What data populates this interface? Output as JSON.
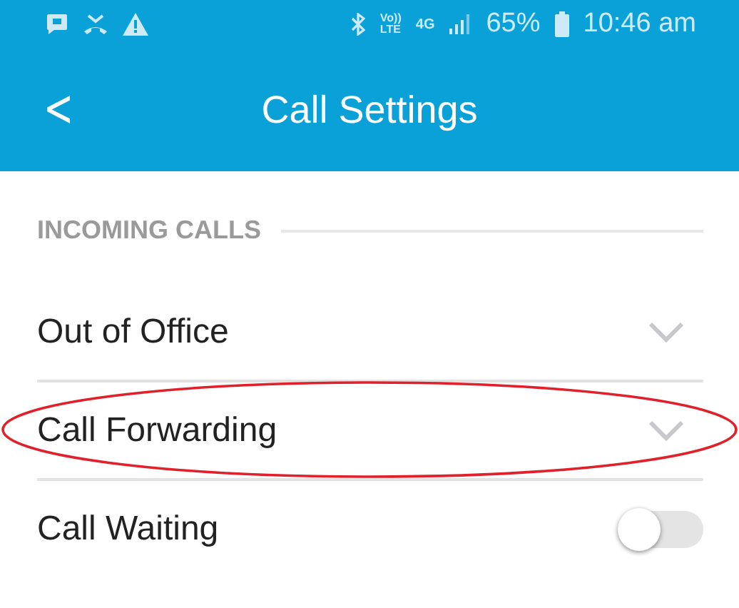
{
  "status_bar": {
    "network_type": "4G",
    "volte_top": "Vo))",
    "volte_bottom": "LTE",
    "battery": "65%",
    "time": "10:46 am"
  },
  "app_bar": {
    "back": "<",
    "title": "Call Settings"
  },
  "section": {
    "title": "INCOMING CALLS"
  },
  "rows": [
    {
      "kind": "dropdown",
      "label": "Out of Office",
      "expanded": false,
      "annotated": false
    },
    {
      "kind": "dropdown",
      "label": "Call Forwarding",
      "expanded": false,
      "annotated": true
    },
    {
      "kind": "toggle",
      "label": "Call Waiting",
      "on": false,
      "annotated": false
    }
  ]
}
